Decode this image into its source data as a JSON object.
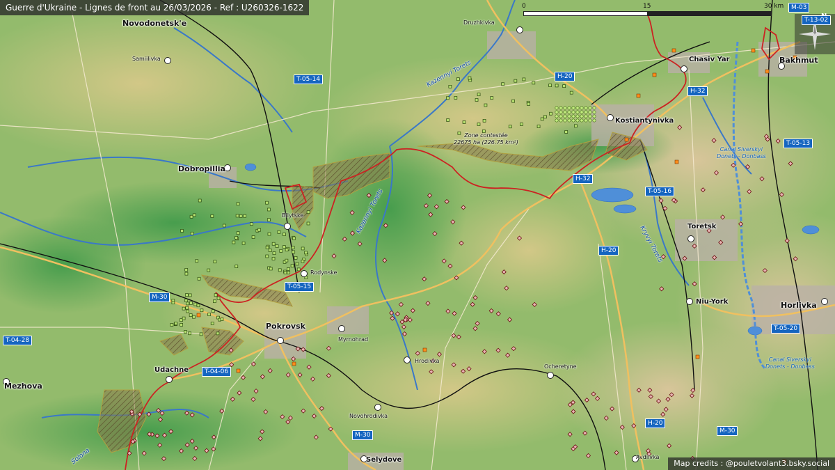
{
  "header": {
    "title": "Guerre d'Ukraine - Lignes de front au 26/03/2026 - Ref : U260326-1622"
  },
  "scale": {
    "labels": [
      "0",
      "15",
      "30 km"
    ]
  },
  "compass": {
    "label": "N"
  },
  "credits": "Map credits : @pouletvolant3.bsky.social",
  "zone": {
    "line1": "Zone contestée",
    "line2": "22675 ha (226.75 km²)"
  },
  "cities": [
    {
      "name": "Bakhmut",
      "size": "city"
    },
    {
      "name": "Chasiv Yar",
      "size": "town"
    },
    {
      "name": "Kostiantynivka",
      "size": "city"
    },
    {
      "name": "Druzhkivka",
      "size": "small"
    },
    {
      "name": "Novodonetsk'e",
      "size": "city"
    },
    {
      "name": "Samiilivka",
      "size": "small"
    },
    {
      "name": "Dobropillia",
      "size": "city"
    },
    {
      "name": "Bilytske",
      "size": "small"
    },
    {
      "name": "Rodynske",
      "size": "small"
    },
    {
      "name": "Pokrovsk",
      "size": "city"
    },
    {
      "name": "Myrnohrad",
      "size": "small"
    },
    {
      "name": "Hrodivka",
      "size": "small"
    },
    {
      "name": "Ocheretyne",
      "size": "small"
    },
    {
      "name": "Novohrodivka",
      "size": "small"
    },
    {
      "name": "Selydove",
      "size": "town"
    },
    {
      "name": "Udachne",
      "size": "town"
    },
    {
      "name": "Mezhova",
      "size": "city"
    },
    {
      "name": "Toretsk",
      "size": "town"
    },
    {
      "name": "Niu-York",
      "size": "town"
    },
    {
      "name": "Horlivka",
      "size": "city"
    },
    {
      "name": "Avdiivka",
      "size": "small"
    }
  ],
  "roads": [
    "M-03",
    "T-13-02",
    "H-20",
    "H-32",
    "T-05-14",
    "T-05-13",
    "H-32",
    "T-05-16",
    "H-20",
    "T-05-15",
    "M-30",
    "T-04-28",
    "T-04-06",
    "T-05-20",
    "H-20",
    "M-30",
    "M-30"
  ],
  "rivers": [
    "Kazennyi Torets",
    "Kryvyi Torets",
    "Kazennyi Torets",
    "Solona"
  ],
  "canals": [
    {
      "line1": "Canal Siverskyi",
      "line2": "Donets - Donbass"
    },
    {
      "line1": "Canal Siverskyi",
      "line2": "Donets - Donbass"
    }
  ],
  "colors": {
    "frontline": "#cc2222",
    "contested": "#8a7a4a",
    "road_badge": "#1565c0",
    "river": "#3a78c8",
    "rail": "#111111"
  }
}
